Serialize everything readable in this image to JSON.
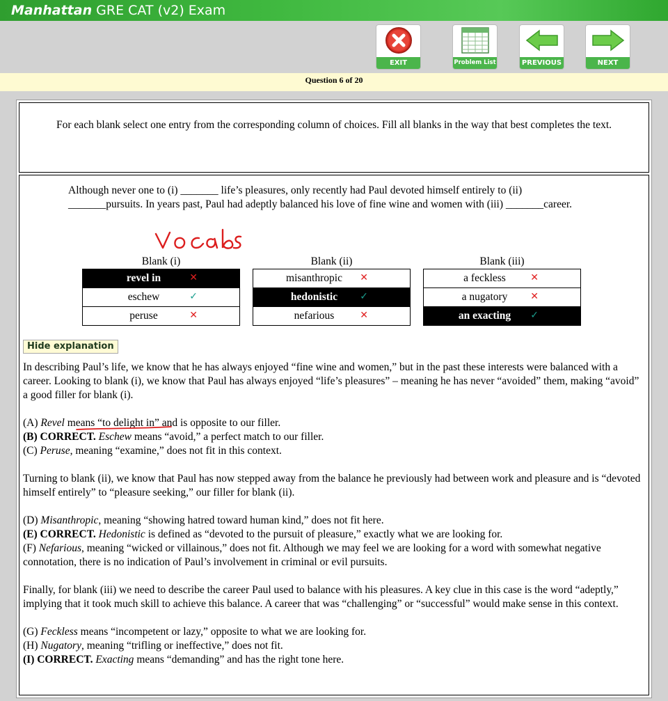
{
  "window": {
    "title_brand": "Manhattan",
    "title_rest": " GRE CAT (v2) Exam"
  },
  "toolbar": {
    "exit": {
      "label": "EXIT",
      "icon": "close-icon"
    },
    "problem_list": {
      "label": "Problem List",
      "icon": "grid-icon"
    },
    "previous": {
      "label": "PREVIOUS",
      "icon": "arrow-left-icon"
    },
    "next": {
      "label": "NEXT",
      "icon": "arrow-right-icon"
    }
  },
  "question_counter": "Question 6 of 20",
  "instructions": "For each blank select one entry from the corresponding column of choices. Fill all blanks in the way that best completes the text.",
  "passage": "Although never one to (i) _______ life’s pleasures, only recently had Paul devoted himself entirely to (ii) _______pursuits. In years past, Paul had adeptly balanced his love of fine wine and women with (iii) _______career.",
  "annotation_handwriting": "vocab",
  "blanks": [
    {
      "header": "Blank (i)",
      "options": [
        {
          "text": "revel in",
          "selected": true,
          "mark": "✕",
          "mark_type": "wrong"
        },
        {
          "text": "eschew",
          "selected": false,
          "mark": "✓",
          "mark_type": "correct"
        },
        {
          "text": "peruse",
          "selected": false,
          "mark": "✕",
          "mark_type": "wrong"
        }
      ]
    },
    {
      "header": "Blank (ii)",
      "options": [
        {
          "text": "misanthropic",
          "selected": false,
          "mark": "✕",
          "mark_type": "wrong"
        },
        {
          "text": "hedonistic",
          "selected": true,
          "mark": "✓",
          "mark_type": "correct"
        },
        {
          "text": "nefarious",
          "selected": false,
          "mark": "✕",
          "mark_type": "wrong"
        }
      ]
    },
    {
      "header": "Blank (iii)",
      "options": [
        {
          "text": "a feckless",
          "selected": false,
          "mark": "✕",
          "mark_type": "wrong"
        },
        {
          "text": "a nugatory",
          "selected": false,
          "mark": "✕",
          "mark_type": "wrong"
        },
        {
          "text": "an exacting",
          "selected": true,
          "mark": "✓",
          "mark_type": "correct"
        }
      ]
    }
  ],
  "hide_explanation_label": "Hide explanation",
  "explanation": {
    "p1": "In describing Paul’s life, we know that he has always enjoyed “fine wine and women,” but in the past these interests were balanced with a career. Looking to blank (i), we know that Paul has always enjoyed “life’s pleasures” – meaning he has never “avoided” them, making “avoid” a good filler for blank (i).",
    "a_pre": "(A) ",
    "a_word": "Revel",
    "a_rest": " means “to delight in” and is opposite to our filler.",
    "b_bold": "(B) CORRECT.",
    "b_word": " Eschew",
    "b_rest": " means “avoid,” a perfect match to our filler.",
    "c_pre": "(C) ",
    "c_word": "Peruse",
    "c_rest": ", meaning “examine,” does not fit in this context.",
    "p2": "Turning to blank (ii), we know that Paul has now stepped away from the balance he previously had between work and pleasure and is “devoted himself entirely” to “pleasure seeking,” our filler for blank (ii).",
    "d_pre": "(D) ",
    "d_word": "Misanthropic",
    "d_rest": ", meaning “showing hatred toward human kind,” does not fit here.",
    "e_bold": "(E) CORRECT.",
    "e_word": " Hedonistic",
    "e_rest": " is defined as “devoted to the pursuit of pleasure,” exactly what we are looking for.",
    "f_pre": "(F) ",
    "f_word": "Nefarious",
    "f_rest": ", meaning “wicked or villainous,” does not fit. Although we may feel we are looking for a word with somewhat negative connotation, there is no indication of Paul’s involvement in criminal or evil pursuits.",
    "p3": "Finally, for blank (iii) we need to describe the career Paul used to balance with his pleasures. A key clue in this case is the word “adeptly,” implying that it took much skill to achieve this balance. A career that was “challenging” or “successful” would make sense in this context.",
    "g_pre": "(G) ",
    "g_word": "Feckless",
    "g_rest": " means “incompetent or lazy,” opposite to what we are looking for.",
    "h_pre": "(H) ",
    "h_word": "Nugatory",
    "h_rest": ", meaning “trifling or ineffective,” does not fit.",
    "i_bold": "(I) CORRECT.",
    "i_word": " Exacting",
    "i_rest": " means “demanding” and has the right tone here."
  },
  "colors": {
    "accent_green": "#4bb54b",
    "wrong_mark": "#e02020",
    "correct_mark": "#1a9e8e",
    "question_bar": "#fefad2"
  }
}
